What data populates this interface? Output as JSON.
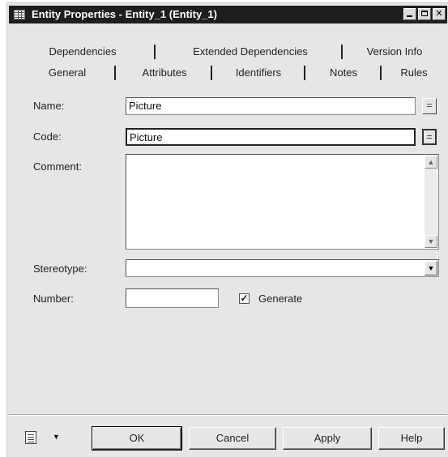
{
  "window": {
    "title": "Entity Properties - Entity_1 (Entity_1)"
  },
  "tabs_back": [
    "Dependencies",
    "Extended Dependencies",
    "Version Info"
  ],
  "tabs_front": [
    "General",
    "Attributes",
    "Identifiers",
    "Notes",
    "Rules"
  ],
  "active_tab": "General",
  "form": {
    "name_label": "Name:",
    "name_value": "Picture",
    "code_label": "Code:",
    "code_value": "Picture",
    "comment_label": "Comment:",
    "comment_value": "",
    "stereotype_label": "Stereotype:",
    "stereotype_value": "",
    "number_label": "Number:",
    "number_value": "",
    "generate_label": "Generate",
    "generate_checked": true,
    "name_btn_glyph": "=",
    "code_btn_glyph": "="
  },
  "buttons": {
    "ok": "OK",
    "cancel": "Cancel",
    "apply": "Apply",
    "help": "Help"
  }
}
